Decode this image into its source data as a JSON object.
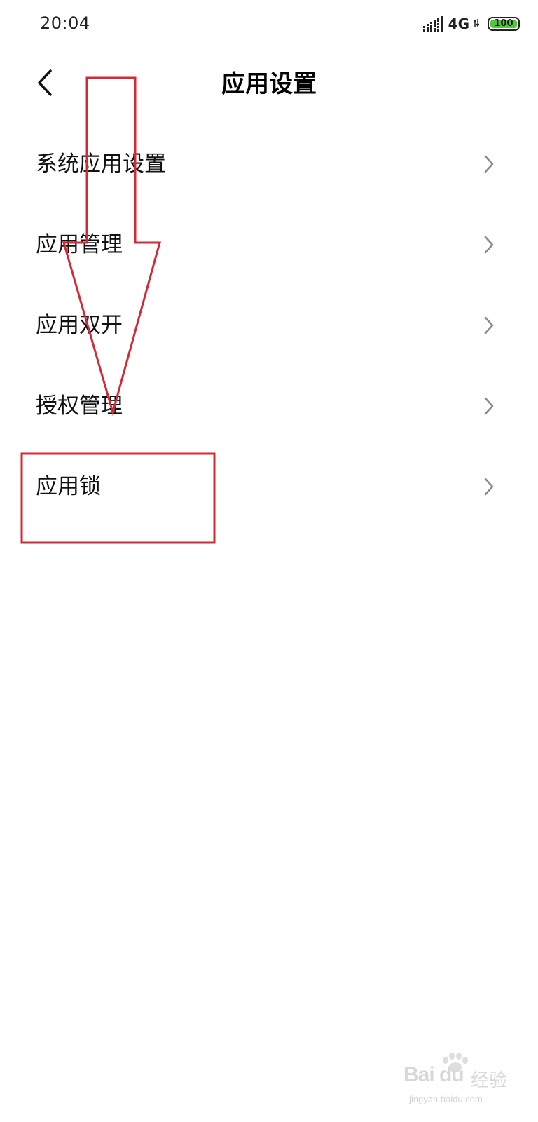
{
  "status_bar": {
    "time": "20:04",
    "network": "4G",
    "battery": "100",
    "signal_icon": "signal-bars-icon",
    "battery_color": "#55c63a"
  },
  "header": {
    "title": "应用设置",
    "back_icon": "chevron-left-icon"
  },
  "settings_list": {
    "items": [
      {
        "label": "系统应用设置"
      },
      {
        "label": "应用管理"
      },
      {
        "label": "应用双开"
      },
      {
        "label": "授权管理"
      },
      {
        "label": "应用锁"
      }
    ]
  },
  "annotations": {
    "color": "#d42a36",
    "shapes": [
      "down-arrow",
      "highlight-box"
    ]
  },
  "watermark": {
    "logo": "Bai du",
    "brand_cn": "经验",
    "url": "jingyan.baidu.com"
  }
}
